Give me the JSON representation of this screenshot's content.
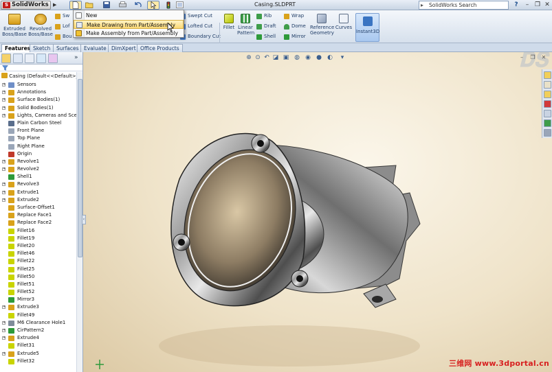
{
  "app": {
    "name": "SolidWorks",
    "document_title": "Casing.SLDPRT",
    "search_placeholder": "SolidWorks Search"
  },
  "ribbon": {
    "extruded_boss": "Extruded Boss/Base",
    "revolved_boss": "Revolved Boss/Base",
    "swept_boss_partial": "Sw",
    "lofted_boss_partial": "Lof",
    "boundary_boss_partial": "Bou",
    "swept_cut": "Swept Cut",
    "lofted_cut": "Lofted Cut",
    "boundary_cut": "Boundary Cut",
    "fillet": "Fillet",
    "linear_pattern": "Linear Pattern",
    "rib": "Rib",
    "draft": "Draft",
    "shell": "Shell",
    "wrap": "Wrap",
    "dome": "Dome",
    "mirror": "Mirror",
    "reference_geometry": "Reference Geometry",
    "curves": "Curves",
    "instant3d": "Instant3D"
  },
  "new_menu": {
    "items": [
      {
        "label": "New"
      },
      {
        "label": "Make Drawing from Part/Assembly"
      },
      {
        "label": "Make Assembly from Part/Assembly"
      }
    ],
    "highlighted_index": 1
  },
  "tabs": [
    {
      "label": "Features",
      "active": true
    },
    {
      "label": "Sketch"
    },
    {
      "label": "Surfaces"
    },
    {
      "label": "Evaluate"
    },
    {
      "label": "DimXpert"
    },
    {
      "label": "Office Products"
    }
  ],
  "feature_tree": {
    "root": "Casing  (Default<<Default>_I",
    "items": [
      {
        "label": "Sensors",
        "icon": "sensor-icon",
        "color": "#6f8fc7"
      },
      {
        "label": "Annotations",
        "icon": "annotations-icon",
        "color": "#d9a21b"
      },
      {
        "label": "Surface Bodies(1)",
        "icon": "surface-bodies-icon",
        "color": "#d9a21b"
      },
      {
        "label": "Solid Bodies(1)",
        "icon": "solid-bodies-icon",
        "color": "#d9a21b"
      },
      {
        "label": "Lights, Cameras and Scen",
        "icon": "lights-icon",
        "color": "#d9a21b"
      },
      {
        "label": "Plain Carbon Steel",
        "icon": "material-icon",
        "color": "#5a6e8c"
      },
      {
        "label": "Front Plane",
        "icon": "plane-icon",
        "color": "#9aa6b8"
      },
      {
        "label": "Top Plane",
        "icon": "plane-icon",
        "color": "#9aa6b8"
      },
      {
        "label": "Right Plane",
        "icon": "plane-icon",
        "color": "#9aa6b8"
      },
      {
        "label": "Origin",
        "icon": "origin-icon",
        "color": "#c0392b"
      },
      {
        "label": "Revolve1",
        "icon": "revolve-icon",
        "color": "#d9a21b"
      },
      {
        "label": "Revolve2",
        "icon": "revolve-icon",
        "color": "#d9a21b"
      },
      {
        "label": "Shell1",
        "icon": "shell-icon",
        "color": "#2e9a3a"
      },
      {
        "label": "Revolve3",
        "icon": "revolve-icon",
        "color": "#d9a21b"
      },
      {
        "label": "Extrude1",
        "icon": "extrude-icon",
        "color": "#d9a21b"
      },
      {
        "label": "Extrude2",
        "icon": "extrude-icon",
        "color": "#d9a21b"
      },
      {
        "label": "Surface-Offset1",
        "icon": "surface-offset-icon",
        "color": "#d9a21b"
      },
      {
        "label": "Replace Face1",
        "icon": "replace-face-icon",
        "color": "#d9a21b"
      },
      {
        "label": "Replace Face2",
        "icon": "replace-face-icon",
        "color": "#d9a21b"
      },
      {
        "label": "Fillet16",
        "icon": "fillet-icon",
        "color": "#c9d400"
      },
      {
        "label": "Fillet19",
        "icon": "fillet-icon",
        "color": "#c9d400"
      },
      {
        "label": "Fillet20",
        "icon": "fillet-icon",
        "color": "#c9d400"
      },
      {
        "label": "Fillet46",
        "icon": "fillet-icon",
        "color": "#c9d400"
      },
      {
        "label": "Fillet22",
        "icon": "fillet-icon",
        "color": "#c9d400"
      },
      {
        "label": "Fillet25",
        "icon": "fillet-icon",
        "color": "#c9d400"
      },
      {
        "label": "Fillet50",
        "icon": "fillet-icon",
        "color": "#c9d400"
      },
      {
        "label": "Fillet51",
        "icon": "fillet-icon",
        "color": "#c9d400"
      },
      {
        "label": "Fillet52",
        "icon": "fillet-icon",
        "color": "#c9d400"
      },
      {
        "label": "Mirror3",
        "icon": "mirror-icon",
        "color": "#2e9a3a"
      },
      {
        "label": "Extrude3",
        "icon": "extrude-icon",
        "color": "#d9a21b"
      },
      {
        "label": "Fillet49",
        "icon": "fillet-icon",
        "color": "#c9d400"
      },
      {
        "label": "M6 Clearance Hole1",
        "icon": "hole-icon",
        "color": "#7f8c9a"
      },
      {
        "label": "CirPattern2",
        "icon": "circular-pattern-icon",
        "color": "#2e9a3a"
      },
      {
        "label": "Extrude4",
        "icon": "extrude-icon",
        "color": "#d9a21b"
      },
      {
        "label": "Fillet31",
        "icon": "fillet-icon",
        "color": "#c9d400"
      },
      {
        "label": "Extrude5",
        "icon": "extrude-icon",
        "color": "#d9a21b"
      },
      {
        "label": "Fillet32",
        "icon": "fillet-icon",
        "color": "#c9d400"
      }
    ]
  },
  "watermark": "三维网 www.3dportal.cn",
  "colors": {
    "accent": "#1f3c66",
    "highlight": "#fbd975",
    "logo_red": "#c21b17",
    "watermark_red": "#d71f1f"
  }
}
